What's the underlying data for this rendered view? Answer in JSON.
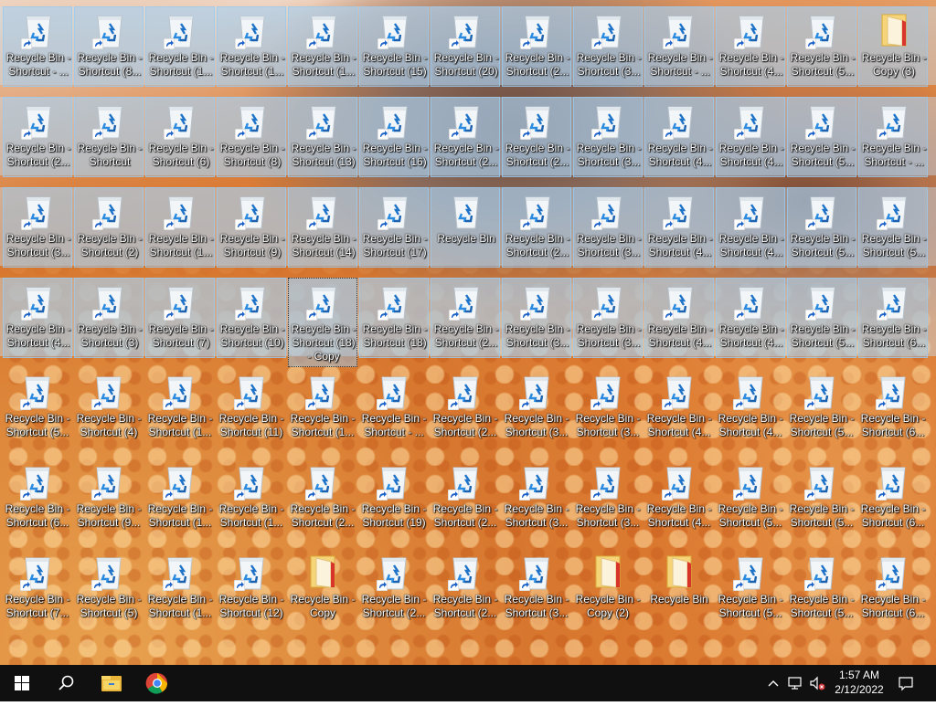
{
  "desktop": {
    "icons": [
      [
        {
          "l1": "Recycle Bin -",
          "l2": "Shortcut - ...",
          "type": "shortcut"
        },
        {
          "l1": "Recycle Bin -",
          "l2": "Shortcut (8...",
          "type": "shortcut"
        },
        {
          "l1": "Recycle Bin -",
          "l2": "Shortcut (1...",
          "type": "shortcut"
        },
        {
          "l1": "Recycle Bin -",
          "l2": "Shortcut (1...",
          "type": "shortcut"
        },
        {
          "l1": "Recycle Bin -",
          "l2": "Shortcut (1...",
          "type": "shortcut"
        },
        {
          "l1": "Recycle Bin -",
          "l2": "Shortcut (15)",
          "type": "shortcut"
        },
        {
          "l1": "Recycle Bin -",
          "l2": "Shortcut (20)",
          "type": "shortcut"
        },
        {
          "l1": "Recycle Bin -",
          "l2": "Shortcut (2...",
          "type": "shortcut"
        },
        {
          "l1": "Recycle Bin -",
          "l2": "Shortcut (3...",
          "type": "shortcut"
        },
        {
          "l1": "Recycle Bin -",
          "l2": "Shortcut - ...",
          "type": "shortcut"
        },
        {
          "l1": "Recycle Bin -",
          "l2": "Shortcut (4...",
          "type": "shortcut"
        },
        {
          "l1": "Recycle Bin -",
          "l2": "Shortcut (5...",
          "type": "shortcut"
        },
        {
          "l1": "Recycle Bin -",
          "l2": "Copy (3)",
          "type": "folder"
        }
      ],
      [
        {
          "l1": "Recycle Bin -",
          "l2": "Shortcut (2...",
          "type": "shortcut"
        },
        {
          "l1": "Recycle Bin -",
          "l2": "Shortcut",
          "type": "shortcut"
        },
        {
          "l1": "Recycle Bin -",
          "l2": "Shortcut (6)",
          "type": "shortcut"
        },
        {
          "l1": "Recycle Bin -",
          "l2": "Shortcut (8)",
          "type": "shortcut"
        },
        {
          "l1": "Recycle Bin -",
          "l2": "Shortcut (13)",
          "type": "shortcut"
        },
        {
          "l1": "Recycle Bin -",
          "l2": "Shortcut (16)",
          "type": "shortcut"
        },
        {
          "l1": "Recycle Bin -",
          "l2": "Shortcut (2...",
          "type": "shortcut"
        },
        {
          "l1": "Recycle Bin -",
          "l2": "Shortcut (2...",
          "type": "shortcut"
        },
        {
          "l1": "Recycle Bin -",
          "l2": "Shortcut (3...",
          "type": "shortcut"
        },
        {
          "l1": "Recycle Bin -",
          "l2": "Shortcut (4...",
          "type": "shortcut"
        },
        {
          "l1": "Recycle Bin -",
          "l2": "Shortcut (4...",
          "type": "shortcut"
        },
        {
          "l1": "Recycle Bin -",
          "l2": "Shortcut (5...",
          "type": "shortcut"
        },
        {
          "l1": "Recycle Bin -",
          "l2": "Shortcut - ...",
          "type": "shortcut"
        }
      ],
      [
        {
          "l1": "Recycle Bin -",
          "l2": "Shortcut (3...",
          "type": "shortcut"
        },
        {
          "l1": "Recycle Bin -",
          "l2": "Shortcut (2)",
          "type": "shortcut"
        },
        {
          "l1": "Recycle Bin -",
          "l2": "Shortcut (1...",
          "type": "shortcut"
        },
        {
          "l1": "Recycle Bin -",
          "l2": "Shortcut (9)",
          "type": "shortcut"
        },
        {
          "l1": "Recycle Bin -",
          "l2": "Shortcut (14)",
          "type": "shortcut"
        },
        {
          "l1": "Recycle Bin -",
          "l2": "Shortcut (17)",
          "type": "shortcut"
        },
        {
          "l1": "Recycle Bin",
          "l2": "",
          "type": "bin"
        },
        {
          "l1": "Recycle Bin -",
          "l2": "Shortcut (2...",
          "type": "shortcut"
        },
        {
          "l1": "Recycle Bin -",
          "l2": "Shortcut (3...",
          "type": "shortcut"
        },
        {
          "l1": "Recycle Bin -",
          "l2": "Shortcut (4...",
          "type": "shortcut"
        },
        {
          "l1": "Recycle Bin -",
          "l2": "Shortcut (4...",
          "type": "shortcut"
        },
        {
          "l1": "Recycle Bin -",
          "l2": "Shortcut (5...",
          "type": "shortcut"
        },
        {
          "l1": "Recycle Bin -",
          "l2": "Shortcut (5...",
          "type": "shortcut"
        }
      ],
      [
        {
          "l1": "Recycle Bin -",
          "l2": "Shortcut (4...",
          "type": "shortcut"
        },
        {
          "l1": "Recycle Bin -",
          "l2": "Shortcut (3)",
          "type": "shortcut"
        },
        {
          "l1": "Recycle Bin -",
          "l2": "Shortcut (7)",
          "type": "shortcut"
        },
        {
          "l1": "Recycle Bin -",
          "l2": "Shortcut (10)",
          "type": "shortcut"
        },
        {
          "l1": "Recycle Bin -",
          "l2": "Shortcut (18)",
          "l3": "- Copy",
          "type": "shortcut"
        },
        {
          "l1": "Recycle Bin -",
          "l2": "Shortcut (18)",
          "type": "shortcut"
        },
        {
          "l1": "Recycle Bin -",
          "l2": "Shortcut (2...",
          "type": "shortcut"
        },
        {
          "l1": "Recycle Bin -",
          "l2": "Shortcut (3...",
          "type": "shortcut"
        },
        {
          "l1": "Recycle Bin -",
          "l2": "Shortcut (3...",
          "type": "shortcut"
        },
        {
          "l1": "Recycle Bin -",
          "l2": "Shortcut (4...",
          "type": "shortcut"
        },
        {
          "l1": "Recycle Bin -",
          "l2": "Shortcut (4...",
          "type": "shortcut"
        },
        {
          "l1": "Recycle Bin -",
          "l2": "Shortcut (5...",
          "type": "shortcut"
        },
        {
          "l1": "Recycle Bin -",
          "l2": "Shortcut (6...",
          "type": "shortcut"
        }
      ],
      [
        {
          "l1": "Recycle Bin -",
          "l2": "Shortcut (5...",
          "type": "shortcut"
        },
        {
          "l1": "Recycle Bin -",
          "l2": "Shortcut (4)",
          "type": "shortcut"
        },
        {
          "l1": "Recycle Bin -",
          "l2": "Shortcut (1...",
          "type": "shortcut"
        },
        {
          "l1": "Recycle Bin -",
          "l2": "Shortcut (11)",
          "type": "shortcut"
        },
        {
          "l1": "Recycle Bin -",
          "l2": "Shortcut (1...",
          "type": "shortcut"
        },
        {
          "l1": "Recycle Bin -",
          "l2": "Shortcut - ...",
          "type": "shortcut"
        },
        {
          "l1": "Recycle Bin -",
          "l2": "Shortcut (2...",
          "type": "shortcut"
        },
        {
          "l1": "Recycle Bin -",
          "l2": "Shortcut (3...",
          "type": "shortcut"
        },
        {
          "l1": "Recycle Bin -",
          "l2": "Shortcut (3...",
          "type": "shortcut"
        },
        {
          "l1": "Recycle Bin -",
          "l2": "Shortcut (4...",
          "type": "shortcut"
        },
        {
          "l1": "Recycle Bin -",
          "l2": "Shortcut (4...",
          "type": "shortcut"
        },
        {
          "l1": "Recycle Bin -",
          "l2": "Shortcut (5...",
          "type": "shortcut"
        },
        {
          "l1": "Recycle Bin -",
          "l2": "Shortcut (6...",
          "type": "shortcut"
        }
      ],
      [
        {
          "l1": "Recycle Bin -",
          "l2": "Shortcut (6...",
          "type": "shortcut"
        },
        {
          "l1": "Recycle Bin -",
          "l2": "Shortcut (9...",
          "type": "shortcut"
        },
        {
          "l1": "Recycle Bin -",
          "l2": "Shortcut (1...",
          "type": "shortcut"
        },
        {
          "l1": "Recycle Bin -",
          "l2": "Shortcut (1...",
          "type": "shortcut"
        },
        {
          "l1": "Recycle Bin -",
          "l2": "Shortcut (2...",
          "type": "shortcut"
        },
        {
          "l1": "Recycle Bin -",
          "l2": "Shortcut (19)",
          "type": "shortcut"
        },
        {
          "l1": "Recycle Bin -",
          "l2": "Shortcut (2...",
          "type": "shortcut"
        },
        {
          "l1": "Recycle Bin -",
          "l2": "Shortcut (3...",
          "type": "shortcut"
        },
        {
          "l1": "Recycle Bin -",
          "l2": "Shortcut (3...",
          "type": "shortcut"
        },
        {
          "l1": "Recycle Bin -",
          "l2": "Shortcut (4...",
          "type": "shortcut"
        },
        {
          "l1": "Recycle Bin -",
          "l2": "Shortcut (5...",
          "type": "shortcut"
        },
        {
          "l1": "Recycle Bin -",
          "l2": "Shortcut (5...",
          "type": "shortcut"
        },
        {
          "l1": "Recycle Bin -",
          "l2": "Shortcut (6...",
          "type": "shortcut"
        }
      ],
      [
        {
          "l1": "Recycle Bin -",
          "l2": "Shortcut (7...",
          "type": "shortcut"
        },
        {
          "l1": "Recycle Bin -",
          "l2": "Shortcut (5)",
          "type": "shortcut"
        },
        {
          "l1": "Recycle Bin -",
          "l2": "Shortcut (1...",
          "type": "shortcut"
        },
        {
          "l1": "Recycle Bin -",
          "l2": "Shortcut (12)",
          "type": "shortcut"
        },
        {
          "l1": "Recycle Bin -",
          "l2": "Copy",
          "type": "folder"
        },
        {
          "l1": "Recycle Bin -",
          "l2": "Shortcut (2...",
          "type": "shortcut"
        },
        {
          "l1": "Recycle Bin -",
          "l2": "Shortcut (2...",
          "type": "shortcut"
        },
        {
          "l1": "Recycle Bin -",
          "l2": "Shortcut (3...",
          "type": "shortcut"
        },
        {
          "l1": "Recycle Bin -",
          "l2": "Copy (2)",
          "type": "folder"
        },
        {
          "l1": "Recycle Bin",
          "l2": "",
          "type": "folder"
        },
        {
          "l1": "Recycle Bin -",
          "l2": "Shortcut (5...",
          "type": "shortcut"
        },
        {
          "l1": "Recycle Bin -",
          "l2": "Shortcut (5...",
          "type": "shortcut"
        },
        {
          "l1": "Recycle Bin -",
          "l2": "Shortcut (6...",
          "type": "shortcut"
        }
      ]
    ],
    "selected_rows": [
      0,
      1,
      2,
      3
    ],
    "focused_icon": "3-4"
  },
  "taskbar": {
    "start_icon": "windows-logo-icon",
    "search_icon": "search-icon",
    "pinned": [
      {
        "name": "file-explorer-icon"
      },
      {
        "name": "chrome-icon"
      }
    ],
    "tray": {
      "chevron_icon": "chevron-up-icon",
      "network_icon": "network-icon",
      "volume_icon": "volume-muted-icon",
      "time": "1:57 AM",
      "date": "2/12/2022",
      "notification_icon": "notification-icon"
    }
  },
  "colors": {
    "taskbar_bg": "#101010",
    "selection": "#99c9ef",
    "bin_blue": "#1e73c8"
  }
}
